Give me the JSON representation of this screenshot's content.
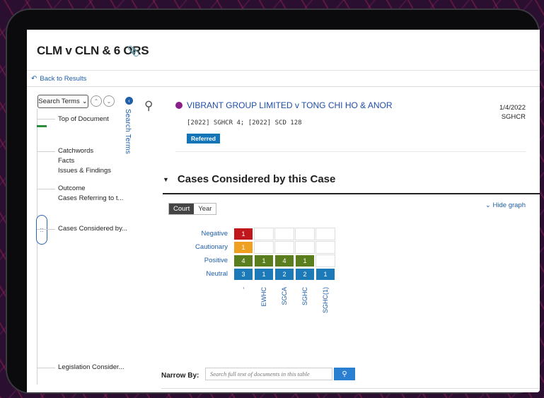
{
  "document": {
    "title": "CLM v CLN & 6 ORS",
    "back_label": "Back to Results"
  },
  "outline": {
    "search_terms_label": "Search Terms",
    "items": [
      "Top of Document",
      "Catchwords",
      "Facts",
      "Issues & Findings",
      "Outcome",
      "Cases Referring to t...",
      "Cases Considered by...",
      "Legislation Consider..."
    ]
  },
  "search_terms_tab": "Search Terms",
  "case": {
    "title": "VIBRANT GROUP LIMITED v TONG CHI HO & ANOR",
    "date": "1/4/2022",
    "court": "SGHCR",
    "citation": "[2022] SGHCR 4; [2022] SCD 128",
    "badge": "Referred"
  },
  "section": {
    "title": "Cases Considered by this Case",
    "toggle_court": "Court",
    "toggle_year": "Year",
    "hide_graph": "Hide graph"
  },
  "graph": {
    "rows": [
      "Negative",
      "Cautionary",
      "Positive",
      "Neutral"
    ],
    "columns": [
      "-",
      "EWHC",
      "SGCA",
      "SGHC",
      "SGHC(1)"
    ],
    "cells": [
      [
        "1",
        "",
        "",
        "",
        ""
      ],
      [
        "1",
        "",
        "",
        "",
        ""
      ],
      [
        "4",
        "1",
        "4",
        "1",
        ""
      ],
      [
        "3",
        "1",
        "2",
        "2",
        "1"
      ]
    ],
    "colors": {
      "Negative": "#c0171c",
      "Cautionary": "#f0a020",
      "Positive": "#5a7d1e",
      "Neutral": "#1c7ab8"
    }
  },
  "narrow": {
    "label": "Narrow By:",
    "placeholder": "Search full text of documents in this table"
  }
}
